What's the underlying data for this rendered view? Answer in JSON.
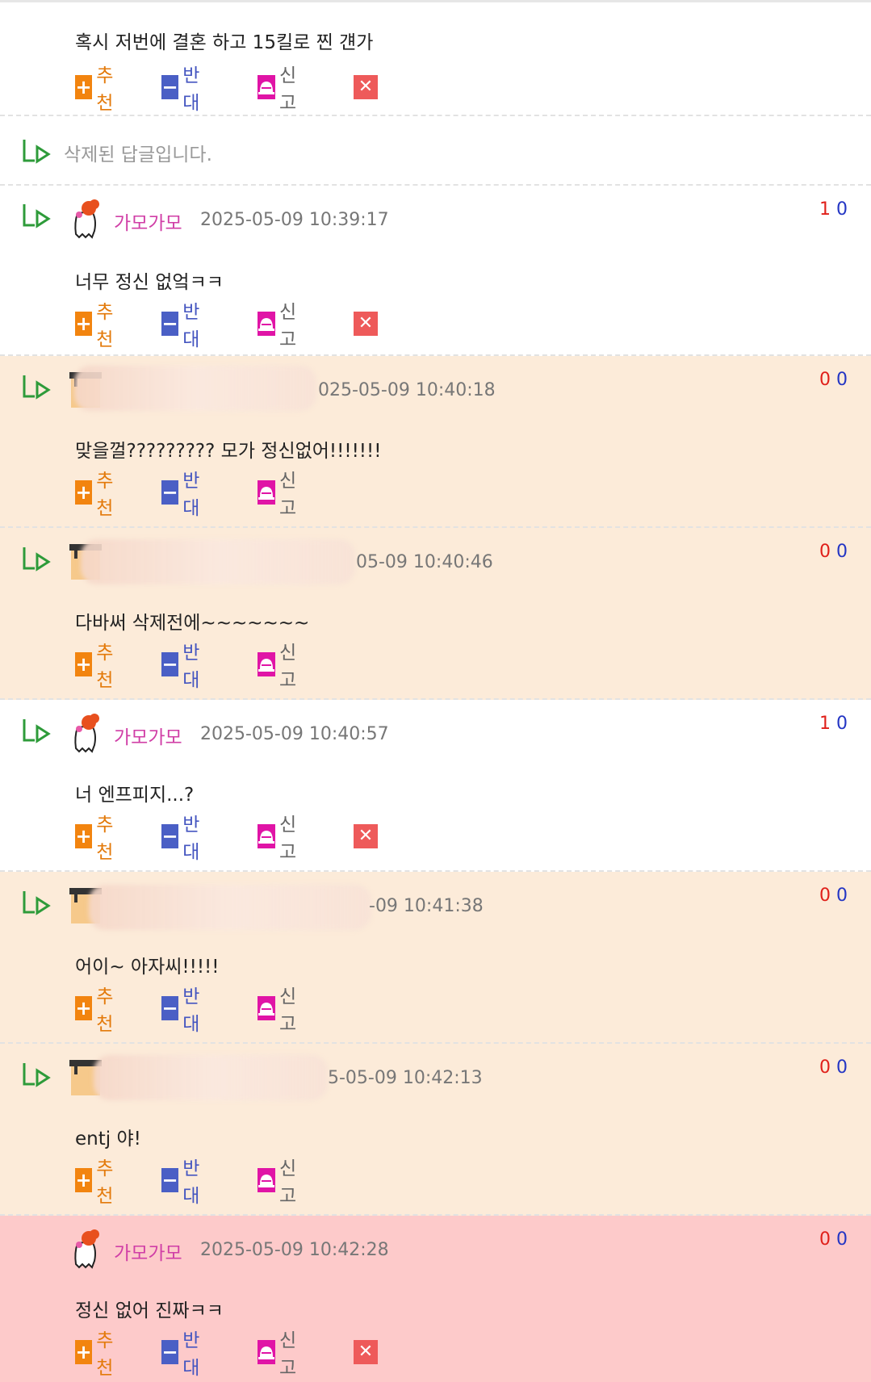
{
  "actions": {
    "recommend": "추천",
    "oppose": "반대",
    "report": "신고"
  },
  "comments": [
    {
      "text": "혹시 저번에 결혼 하고 15킬로 찐 걘가"
    },
    {
      "deleted_text": "삭제된 답글입니다."
    },
    {
      "nick": "가모가모",
      "time": "2025-05-09 10:39:17",
      "up": "1",
      "down": "0",
      "text": "너무 정신 없엌ㅋㅋ"
    },
    {
      "time": "025-05-09 10:40:18",
      "up": "0",
      "down": "0",
      "text": "맞을껄????????? 모가 정신없어!!!!!!!"
    },
    {
      "time": "05-09 10:40:46",
      "up": "0",
      "down": "0",
      "text": "다바써 삭제전에~~~~~~~"
    },
    {
      "nick": "가모가모",
      "time": "2025-05-09 10:40:57",
      "up": "1",
      "down": "0",
      "text": "너 엔프피지...?"
    },
    {
      "time": "-09 10:41:38",
      "up": "0",
      "down": "0",
      "text": "어이~ 아자씨!!!!!"
    },
    {
      "time": "5-05-09 10:42:13",
      "up": "0",
      "down": "0",
      "text": "entj 야!"
    },
    {
      "nick": "가모가모",
      "time": "2025-05-09 10:42:28",
      "up": "0",
      "down": "0",
      "text": "정신 없어 진짜ㅋㅋ"
    }
  ]
}
